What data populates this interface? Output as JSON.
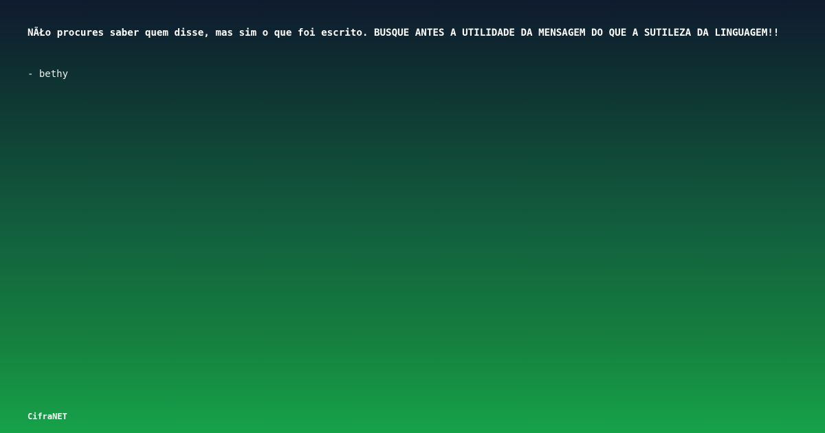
{
  "quote": {
    "text": "NÃŁo procures saber quem disse, mas sim o que foi escrito. BUSQUE ANTES A UTILIDADE DA MENSAGEM DO QUE A SUTILEZA DA LINGUAGEM!!",
    "author": "- bethy"
  },
  "brand": {
    "name": "CifraNET"
  },
  "colors": {
    "gradient_top": "#0f1a2e",
    "gradient_bottom": "#16a249",
    "text": "#ffffff"
  }
}
